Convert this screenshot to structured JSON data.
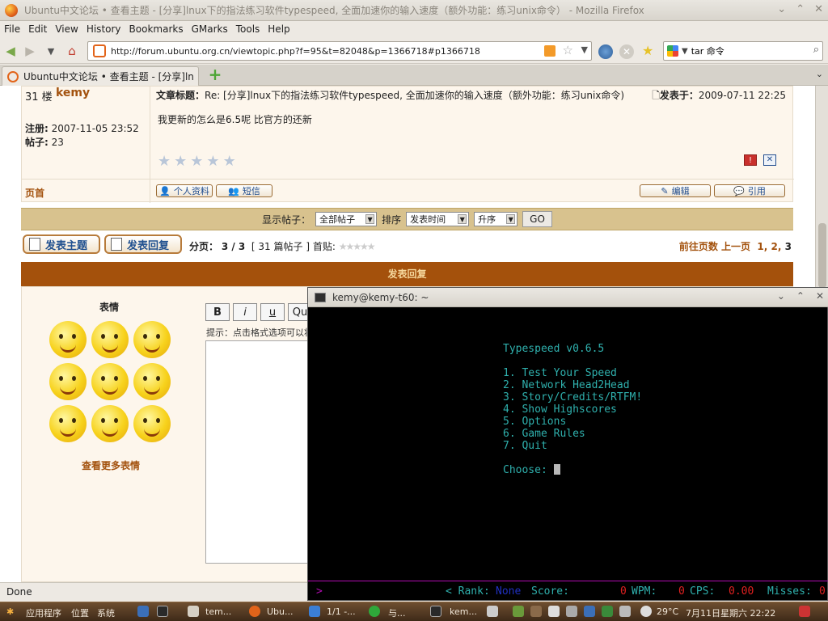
{
  "window": {
    "title": "Ubuntu中文论坛 • 查看主题 - [分享]lnux下的指法练习软件typespeed, 全面加速你的输入速度（额外功能：练习unix命令） - Mozilla Firefox"
  },
  "menu": {
    "file": "File",
    "edit": "Edit",
    "view": "View",
    "history": "History",
    "bookmarks": "Bookmarks",
    "gmarks": "GMarks",
    "tools": "Tools",
    "help": "Help"
  },
  "nav": {
    "url": "http://forum.ubuntu.org.cn/viewtopic.php?f=95&t=82048&p=1366718#p1366718",
    "search_value": "tar 命令"
  },
  "tab": {
    "label": "Ubuntu中文论坛 • 查看主题 - [分享]lnux..."
  },
  "post": {
    "number": "31 楼",
    "author": "kemy",
    "subject_label": "文章标题：",
    "subject": "Re: [分享]lnux下的指法练习软件typespeed, 全面加速你的输入速度（额外功能：练习unix命令)",
    "posted_label": "发表于：",
    "posted": "2009-07-11 22:25",
    "body": "我更新的怎么是6.5呢 比官方的还新",
    "reg_label": "注册:",
    "reg_date": "2007-11-05 23:52",
    "posts_label": "帖子:",
    "posts": "23",
    "top_link": "页首",
    "profile_btn": "个人资料",
    "pm_btn": "短信",
    "edit_btn": "编辑",
    "quote_btn": "引用"
  },
  "sortbar": {
    "display_label": "显示帖子：",
    "display_value": "全部帖子",
    "sort_label": "排序",
    "sort_value": "发表时间",
    "order_value": "升序",
    "go": "GO"
  },
  "actions": {
    "new_topic": "发表主题",
    "reply": "发表回复",
    "page_label": "分页：",
    "page_value": "3 / 3",
    "post_count": "[ 31 篇帖子 ]",
    "first_page": "首贴:",
    "goto_label": "前往页数",
    "prev": "上一页",
    "p1": "1",
    "p2": "2",
    "p3": "3"
  },
  "reply_section": {
    "header": "发表回复",
    "emoticons_title": "表情",
    "more_emoticons": "查看更多表情",
    "bold": "B",
    "italic": "i",
    "underline": "u",
    "quote": "Qu",
    "hint": "提示：点击格式选项可以将"
  },
  "terminal": {
    "title": "kemy@kemy-t60: ~",
    "heading": "Typespeed v0.6.5",
    "items": [
      "1. Test Your Speed",
      "2. Network Head2Head",
      "3. Story/Credits/RTFM!",
      "4. Show Highscores",
      "5. Options",
      "6. Game Rules",
      "7. Quit"
    ],
    "prompt": "Choose: ",
    "status_prompt": ">",
    "rank_label": "< Rank:",
    "rank_value": "None",
    "score_label": "Score:",
    "score_value": "0",
    "wpm_label": "WPM:",
    "wpm_value": "0",
    "cps_label": "CPS:",
    "cps_value": "0.00",
    "misses_label": "Misses:",
    "misses_value": "0"
  },
  "statusbar": {
    "text": "Done"
  },
  "panel": {
    "apps": "应用程序",
    "places": "位置",
    "system": "系统",
    "task_terminal": "tem...",
    "task_firefox": "Ubu...",
    "task_pages": "1/1 -...",
    "task_im": "与...",
    "task_kemy": "kem...",
    "weather": "29°C",
    "clock": "7月11日星期六 22:22"
  },
  "colors": {
    "forum_brown": "#a4510c",
    "terminal_text": "#2fb0ad",
    "status_red": "#e02020",
    "status_blue": "#2030c0"
  }
}
